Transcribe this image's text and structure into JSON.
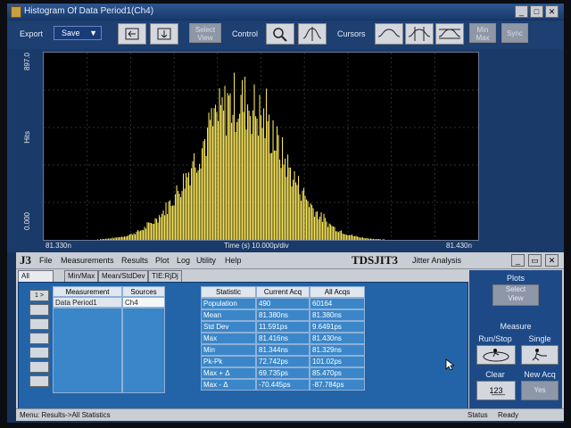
{
  "window": {
    "title": "Histogram Of Data Period1(Ch4)"
  },
  "toolbar": {
    "export_label": "Export",
    "save_label": "Save",
    "save_arrow": "▼",
    "select_view_line1": "Select",
    "select_view_line2": "View",
    "control_label": "Control",
    "cursors_label": "Cursors",
    "minmax_label": "Min Max",
    "sync_label": "Sync"
  },
  "chart_data": {
    "type": "histogram",
    "ylabel": "Hits",
    "ymax_label": "897.0",
    "ymin_label": "0.000",
    "xmin_label": "81.330n",
    "xmax_label": "81.430n",
    "xcenter_label": "Time (s)  10.000p/div",
    "ylim": [
      0,
      897
    ],
    "bar_color": "#f2e15a",
    "peak_at_fraction": 0.45,
    "gridlines": true
  },
  "app": {
    "logo": "J3",
    "menu": [
      "File",
      "Measurements",
      "Results",
      "Plot",
      "Log",
      "Utility",
      "Help"
    ],
    "brand": "TDSJIT3",
    "brand_sub": "Jitter Analysis"
  },
  "tabs": [
    "All Statistics",
    "Min/Max",
    "Mean/StdDev",
    "TIE:RjDj - BER"
  ],
  "measure_table": {
    "headers": [
      "Measurement",
      "Sources"
    ],
    "row": {
      "measurement": "Data Period1",
      "source": "Ch4"
    },
    "first_row_button": "1 >"
  },
  "stats": {
    "headers": [
      "Statistic",
      "Current Acq",
      "All Acqs"
    ],
    "rows": [
      {
        "name": "Population",
        "current": "490",
        "all": "60164"
      },
      {
        "name": "Mean",
        "current": "81.380ns",
        "all": "81.380ns"
      },
      {
        "name": "Std Dev",
        "current": "11.591ps",
        "all": "9.6491ps"
      },
      {
        "name": "Max",
        "current": "81.416ns",
        "all": "81.430ns"
      },
      {
        "name": "Min",
        "current": "81.344ns",
        "all": "81.329ns"
      },
      {
        "name": "Pk-Pk",
        "current": "72.742ps",
        "all": "101.02ps"
      },
      {
        "name": "Max + Δ",
        "current": "69.735ps",
        "all": "85.470ps"
      },
      {
        "name": "Max - Δ",
        "current": "-70.445ps",
        "all": "-87.784ps"
      }
    ]
  },
  "side": {
    "plots_label": "Plots",
    "select_line1": "Select",
    "select_line2": "View",
    "measure_label": "Measure",
    "runstop_label": "Run/Stop",
    "single_label": "Single",
    "clear_label": "Clear",
    "newacq_label": "New Acq",
    "yes_label": "Yes",
    "clear_glyph": "1̲2̲3̲"
  },
  "status": {
    "left": "Menu: Results->All Statistics",
    "status_label": "Status",
    "state": "Ready"
  }
}
